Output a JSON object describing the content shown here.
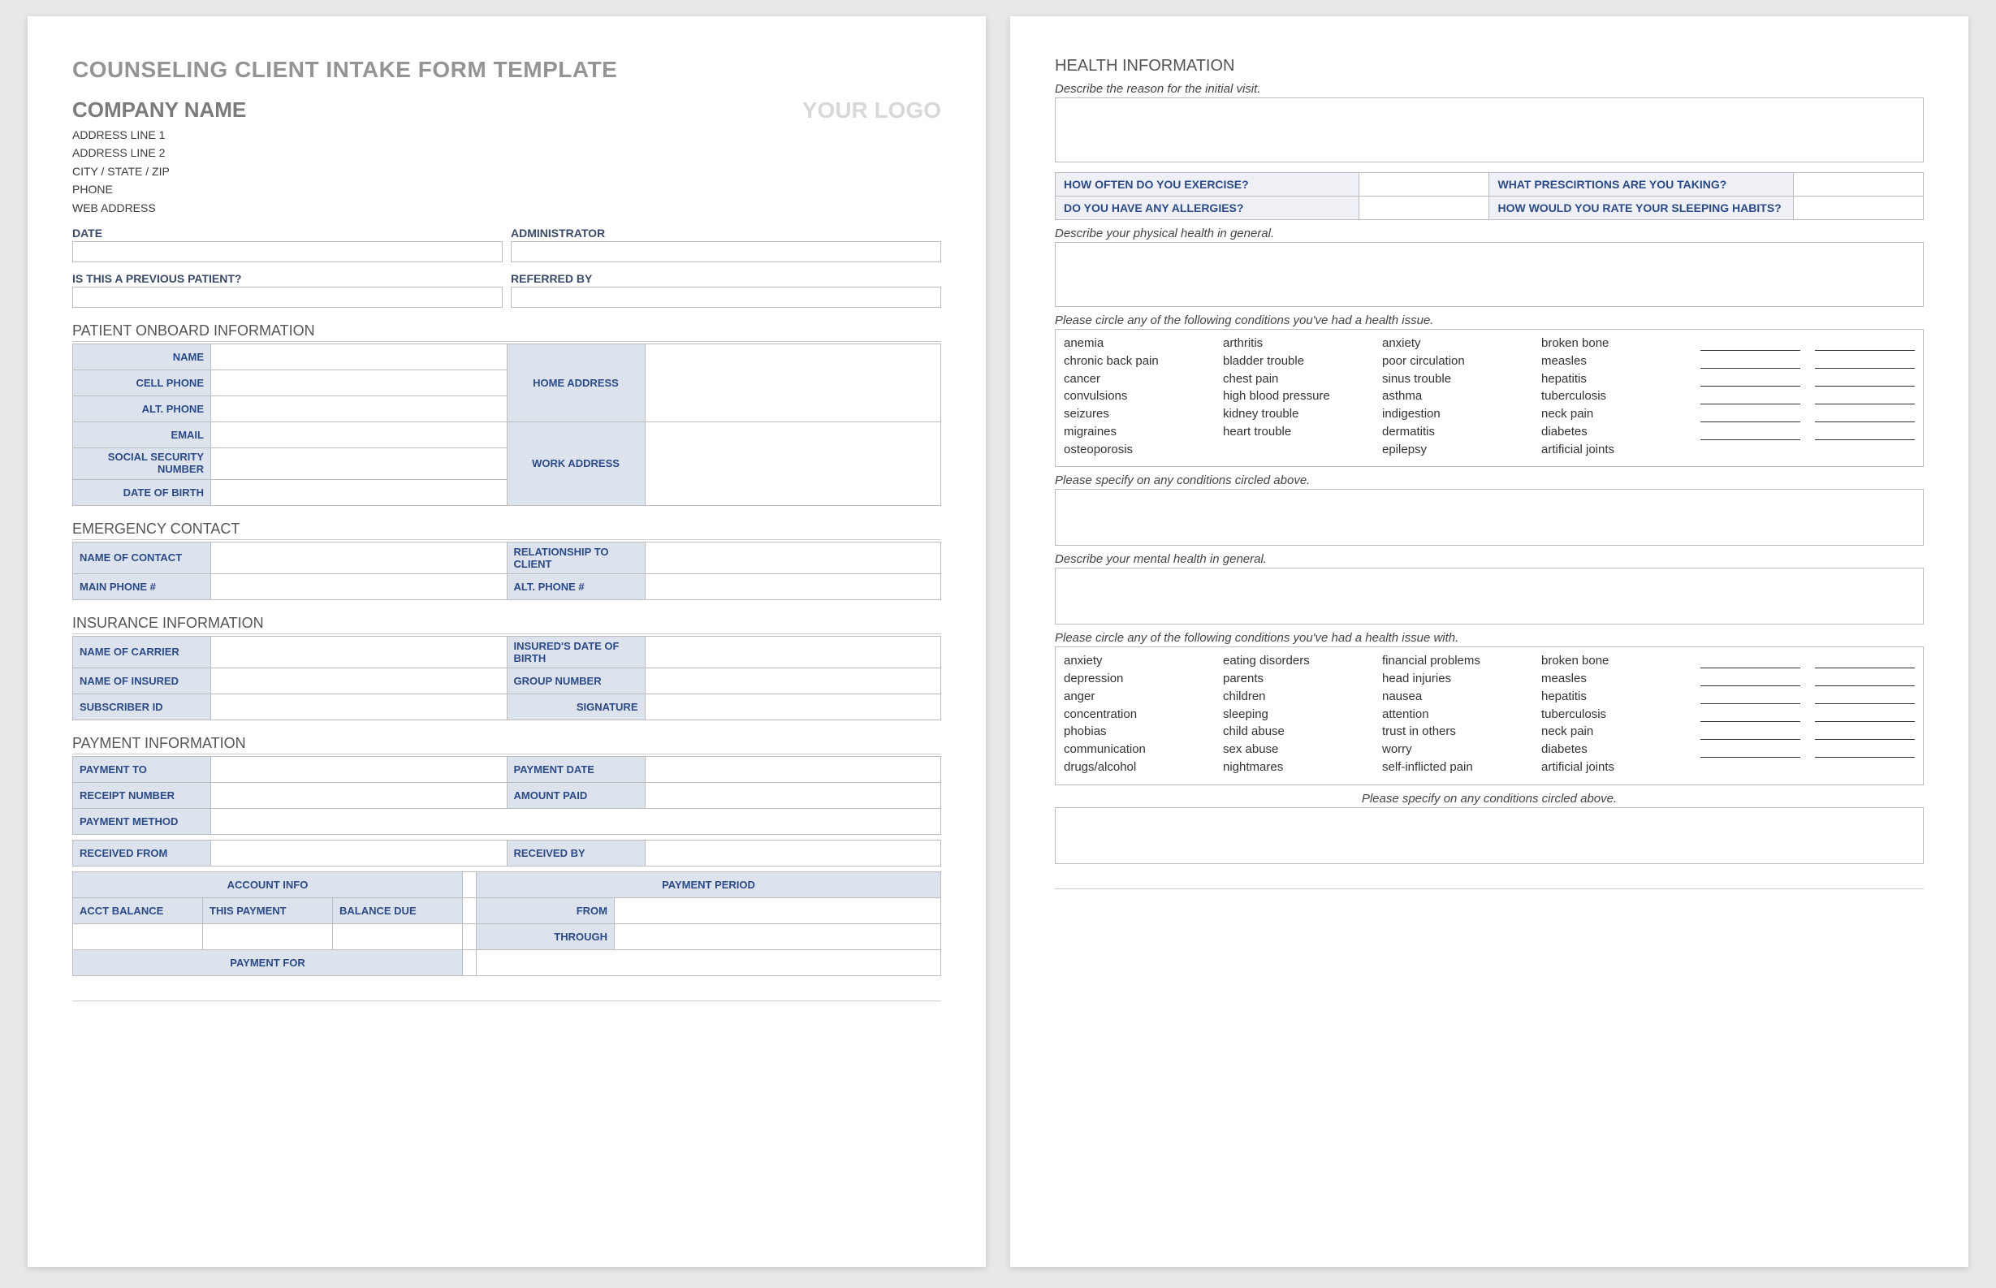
{
  "page1": {
    "title": "COUNSELING CLIENT INTAKE FORM TEMPLATE",
    "company": {
      "name": "COMPANY NAME",
      "addr1": "ADDRESS LINE 1",
      "addr2": "ADDRESS LINE 2",
      "city": "CITY / STATE / ZIP",
      "phone": "PHONE",
      "web": "WEB ADDRESS"
    },
    "logo": "YOUR LOGO",
    "top_fields": {
      "date": "DATE",
      "admin": "ADMINISTRATOR",
      "prev_patient": "IS THIS A PREVIOUS PATIENT?",
      "referred": "REFERRED BY"
    },
    "onboard": {
      "heading": "PATIENT ONBOARD INFORMATION",
      "name": "NAME",
      "cell": "CELL PHONE",
      "alt": "ALT. PHONE",
      "email": "EMAIL",
      "ssn": "SOCIAL SECURITY NUMBER",
      "dob": "DATE OF BIRTH",
      "home": "HOME ADDRESS",
      "work": "WORK ADDRESS"
    },
    "emergency": {
      "heading": "EMERGENCY CONTACT",
      "name": "NAME OF CONTACT",
      "rel": "RELATIONSHIP TO CLIENT",
      "main": "MAIN PHONE #",
      "alt": "ALT. PHONE #"
    },
    "insurance": {
      "heading": "INSURANCE INFORMATION",
      "carrier": "NAME OF CARRIER",
      "idob": "INSURED'S DATE OF BIRTH",
      "insured": "NAME OF INSURED",
      "group": "GROUP NUMBER",
      "sub": "SUBSCRIBER ID",
      "sig": "SIGNATURE"
    },
    "payment": {
      "heading": "PAYMENT INFORMATION",
      "to": "PAYMENT TO",
      "date": "PAYMENT DATE",
      "receipt": "RECEIPT NUMBER",
      "amount": "AMOUNT PAID",
      "method": "PAYMENT METHOD",
      "rfrom": "RECEIVED FROM",
      "rby": "RECEIVED BY",
      "acctinfo": "ACCOUNT INFO",
      "period": "PAYMENT PERIOD",
      "balance": "ACCT BALANCE",
      "thispay": "THIS PAYMENT",
      "baldue": "BALANCE DUE",
      "from": "FROM",
      "through": "THROUGH",
      "for": "PAYMENT FOR"
    }
  },
  "page2": {
    "heading": "HEALTH INFORMATION",
    "reason": "Describe the reason for the initial visit.",
    "q1": "HOW OFTEN DO YOU EXERCISE?",
    "q2": "WHAT PRESCIRTIONS ARE YOU TAKING?",
    "q3": "DO YOU HAVE ANY ALLERGIES?",
    "q4": "HOW WOULD YOU RATE YOUR SLEEPING HABITS?",
    "phys_desc": "Describe your physical health in general.",
    "circle1": "Please circle any of the following conditions you've had a health issue.",
    "phys_cols": [
      [
        "anemia",
        "chronic back pain",
        "cancer",
        "convulsions",
        "seizures",
        "migraines",
        "osteoporosis"
      ],
      [
        "arthritis",
        "bladder trouble",
        "chest pain",
        "high blood pressure",
        "kidney trouble",
        "heart trouble"
      ],
      [
        "anxiety",
        "poor circulation",
        "sinus trouble",
        "asthma",
        "indigestion",
        "dermatitis",
        "epilepsy"
      ],
      [
        "broken bone",
        "measles",
        "hepatitis",
        "tuberculosis",
        "neck pain",
        "diabetes",
        "artificial joints"
      ]
    ],
    "spec1": "Please specify on any conditions circled above.",
    "ment_desc": "Describe your mental health in general.",
    "circle2": "Please circle any of the following conditions you've had a health issue with.",
    "ment_cols": [
      [
        "anxiety",
        "depression",
        "anger",
        "concentration",
        "phobias",
        "communication",
        "drugs/alcohol"
      ],
      [
        "eating disorders",
        "parents",
        "children",
        "sleeping",
        "child abuse",
        "sex abuse",
        "nightmares"
      ],
      [
        "financial problems",
        "head injuries",
        "nausea",
        "attention",
        "trust in others",
        "worry",
        "self-inflicted pain"
      ],
      [
        "broken bone",
        "measles",
        "hepatitis",
        "tuberculosis",
        "neck pain",
        "diabetes",
        "artificial joints"
      ]
    ],
    "spec2": "Please specify on any conditions circled above."
  }
}
